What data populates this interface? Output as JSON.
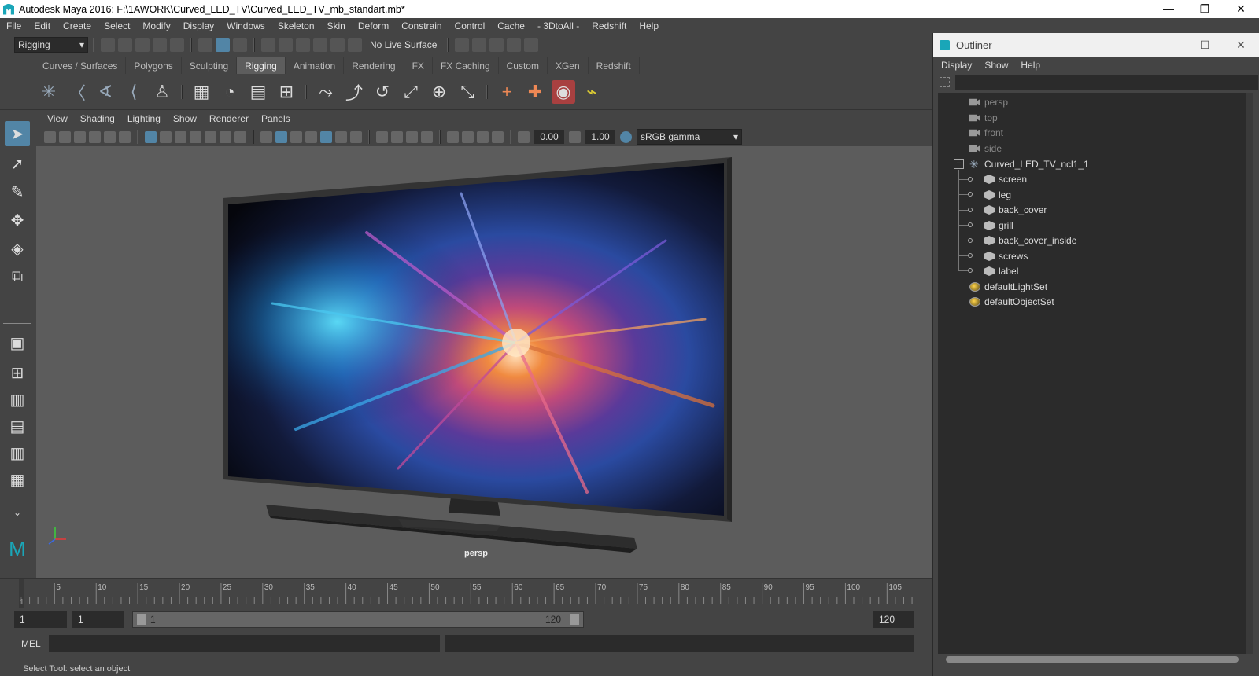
{
  "window_title": "Autodesk Maya 2016: F:\\1AWORK\\Curved_LED_TV\\Curved_LED_TV_mb_standart.mb*",
  "menubar": [
    "File",
    "Edit",
    "Create",
    "Select",
    "Modify",
    "Display",
    "Windows",
    "Skeleton",
    "Skin",
    "Deform",
    "Constrain",
    "Control",
    "Cache",
    "- 3DtoAll -",
    "Redshift",
    "Help"
  ],
  "mode_dropdown": "Rigging",
  "live_surface": "No Live Surface",
  "shelf_tabs": [
    "Curves / Surfaces",
    "Polygons",
    "Sculpting",
    "Rigging",
    "Animation",
    "Rendering",
    "FX",
    "FX Caching",
    "Custom",
    "XGen",
    "Redshift"
  ],
  "active_shelf_tab": "Rigging",
  "viewport_menu": [
    "View",
    "Shading",
    "Lighting",
    "Show",
    "Renderer",
    "Panels"
  ],
  "viewport_fields": {
    "exposure": "0.00",
    "gamma": "1.00",
    "color_space": "sRGB gamma"
  },
  "camera_label": "persp",
  "timeline_ticks": [
    "1",
    "5",
    "10",
    "15",
    "20",
    "25",
    "30",
    "35",
    "40",
    "45",
    "50",
    "55",
    "60",
    "65",
    "70",
    "75",
    "80",
    "85",
    "90",
    "95",
    "100",
    "105"
  ],
  "range": {
    "start": "1",
    "current": "1",
    "slider_start": "1",
    "slider_end": "120",
    "end": "120"
  },
  "mel_label": "MEL",
  "help_line": "Select Tool: select an object",
  "outliner": {
    "title": "Outliner",
    "menu": [
      "Display",
      "Show",
      "Help"
    ],
    "cameras": [
      "persp",
      "top",
      "front",
      "side"
    ],
    "group": "Curved_LED_TV_ncl1_1",
    "children": [
      "screen",
      "leg",
      "back_cover",
      "grill",
      "back_cover_inside",
      "screws",
      "label"
    ],
    "sets": [
      "defaultLightSet",
      "defaultObjectSet"
    ]
  },
  "colors": {
    "accent": "#5285a6",
    "maya_logo": "#1aa6b8",
    "panel": "#444444",
    "viewport_bg": "#5c5c5c"
  }
}
